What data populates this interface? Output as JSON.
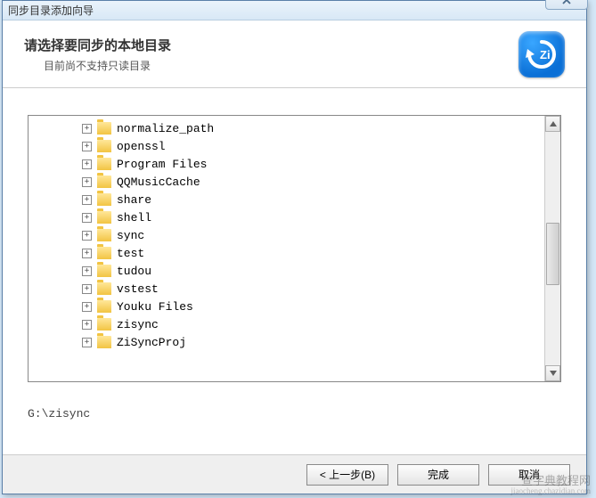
{
  "window": {
    "title": "同步目录添加向导"
  },
  "header": {
    "title": "请选择要同步的本地目录",
    "subtitle": "目前尚不支持只读目录"
  },
  "tree": {
    "items": [
      {
        "label": "normalize_path"
      },
      {
        "label": "openssl"
      },
      {
        "label": "Program Files"
      },
      {
        "label": "QQMusicCache"
      },
      {
        "label": "share"
      },
      {
        "label": "shell"
      },
      {
        "label": "sync"
      },
      {
        "label": "test"
      },
      {
        "label": "tudou"
      },
      {
        "label": "vstest"
      },
      {
        "label": "Youku Files"
      },
      {
        "label": "zisync"
      },
      {
        "label": "ZiSyncProj"
      }
    ]
  },
  "selected_path": "G:\\zisync",
  "buttons": {
    "back": "< 上一步(B)",
    "finish": "完成",
    "cancel": "取消"
  },
  "watermark": {
    "line1": "查字典教程网",
    "line2": "jiaocheng.chazidian.com"
  },
  "logo_text": "Zi"
}
